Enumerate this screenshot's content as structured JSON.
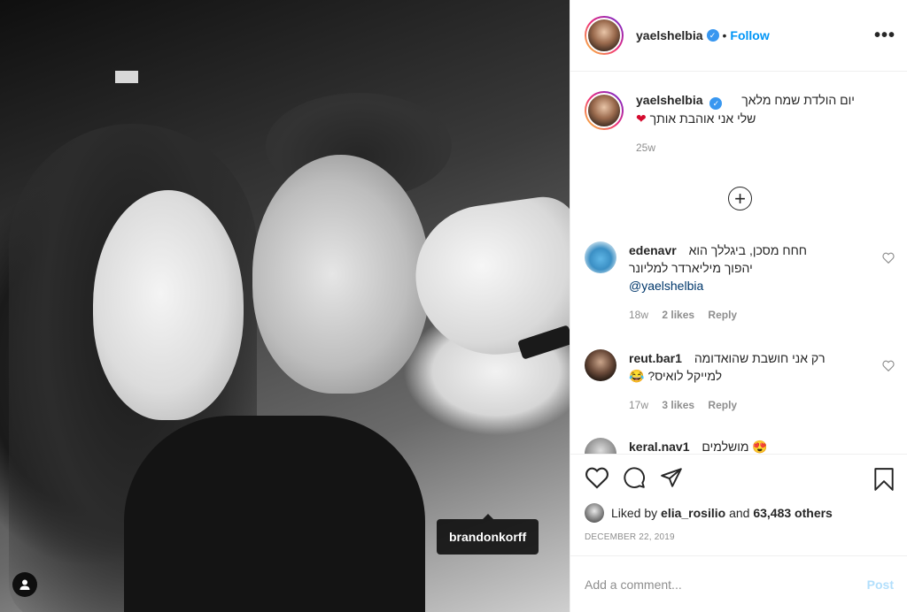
{
  "photo": {
    "tagged_user": "brandonkorff"
  },
  "header": {
    "username": "yaelshelbia",
    "separator": "•",
    "follow_label": "Follow",
    "more_label": "•••"
  },
  "caption": {
    "username": "yaelshelbia",
    "text_line1": "יום הולדת שמח מלאך",
    "text_line2": "שלי אני אוהבת אותך",
    "emoji": "❤",
    "age": "25w"
  },
  "load_more": {
    "label": "+"
  },
  "comments": [
    {
      "username": "edenavr",
      "text_line1": "חחח מסכן, ביגללך הוא",
      "text_line2": "יהפוך מיליארדר למליונר",
      "mention": "@yaelshelbia",
      "age": "18w",
      "likes": "2 likes",
      "reply": "Reply"
    },
    {
      "username": "reut.bar1",
      "text_line1": "רק אני חושבת שהואדומה",
      "text_line2": "?למייקל לואיס",
      "emoji": "😂",
      "age": "17w",
      "likes": "3 likes",
      "reply": "Reply"
    },
    {
      "username": "keral.nav1",
      "text_line1": "מושלמים",
      "emoji": "😍"
    }
  ],
  "actions": {
    "liked_by_prefix": "Liked by ",
    "liked_by_user": "elia_rosilio",
    "liked_by_and": " and ",
    "others": "63,483 others",
    "date": "DECEMBER 22, 2019"
  },
  "add_comment": {
    "placeholder": "Add a comment...",
    "post_label": "Post"
  },
  "colors": {
    "link_blue": "#0095f6",
    "verified_blue": "#3897f0",
    "heart_red": "#d40b2f",
    "muted": "#8e8e8e"
  },
  "icons": [
    "user-tag-icon",
    "verified-icon",
    "more-icon",
    "plus-circle-icon",
    "heart-icon",
    "comment-icon",
    "share-icon",
    "bookmark-icon"
  ]
}
